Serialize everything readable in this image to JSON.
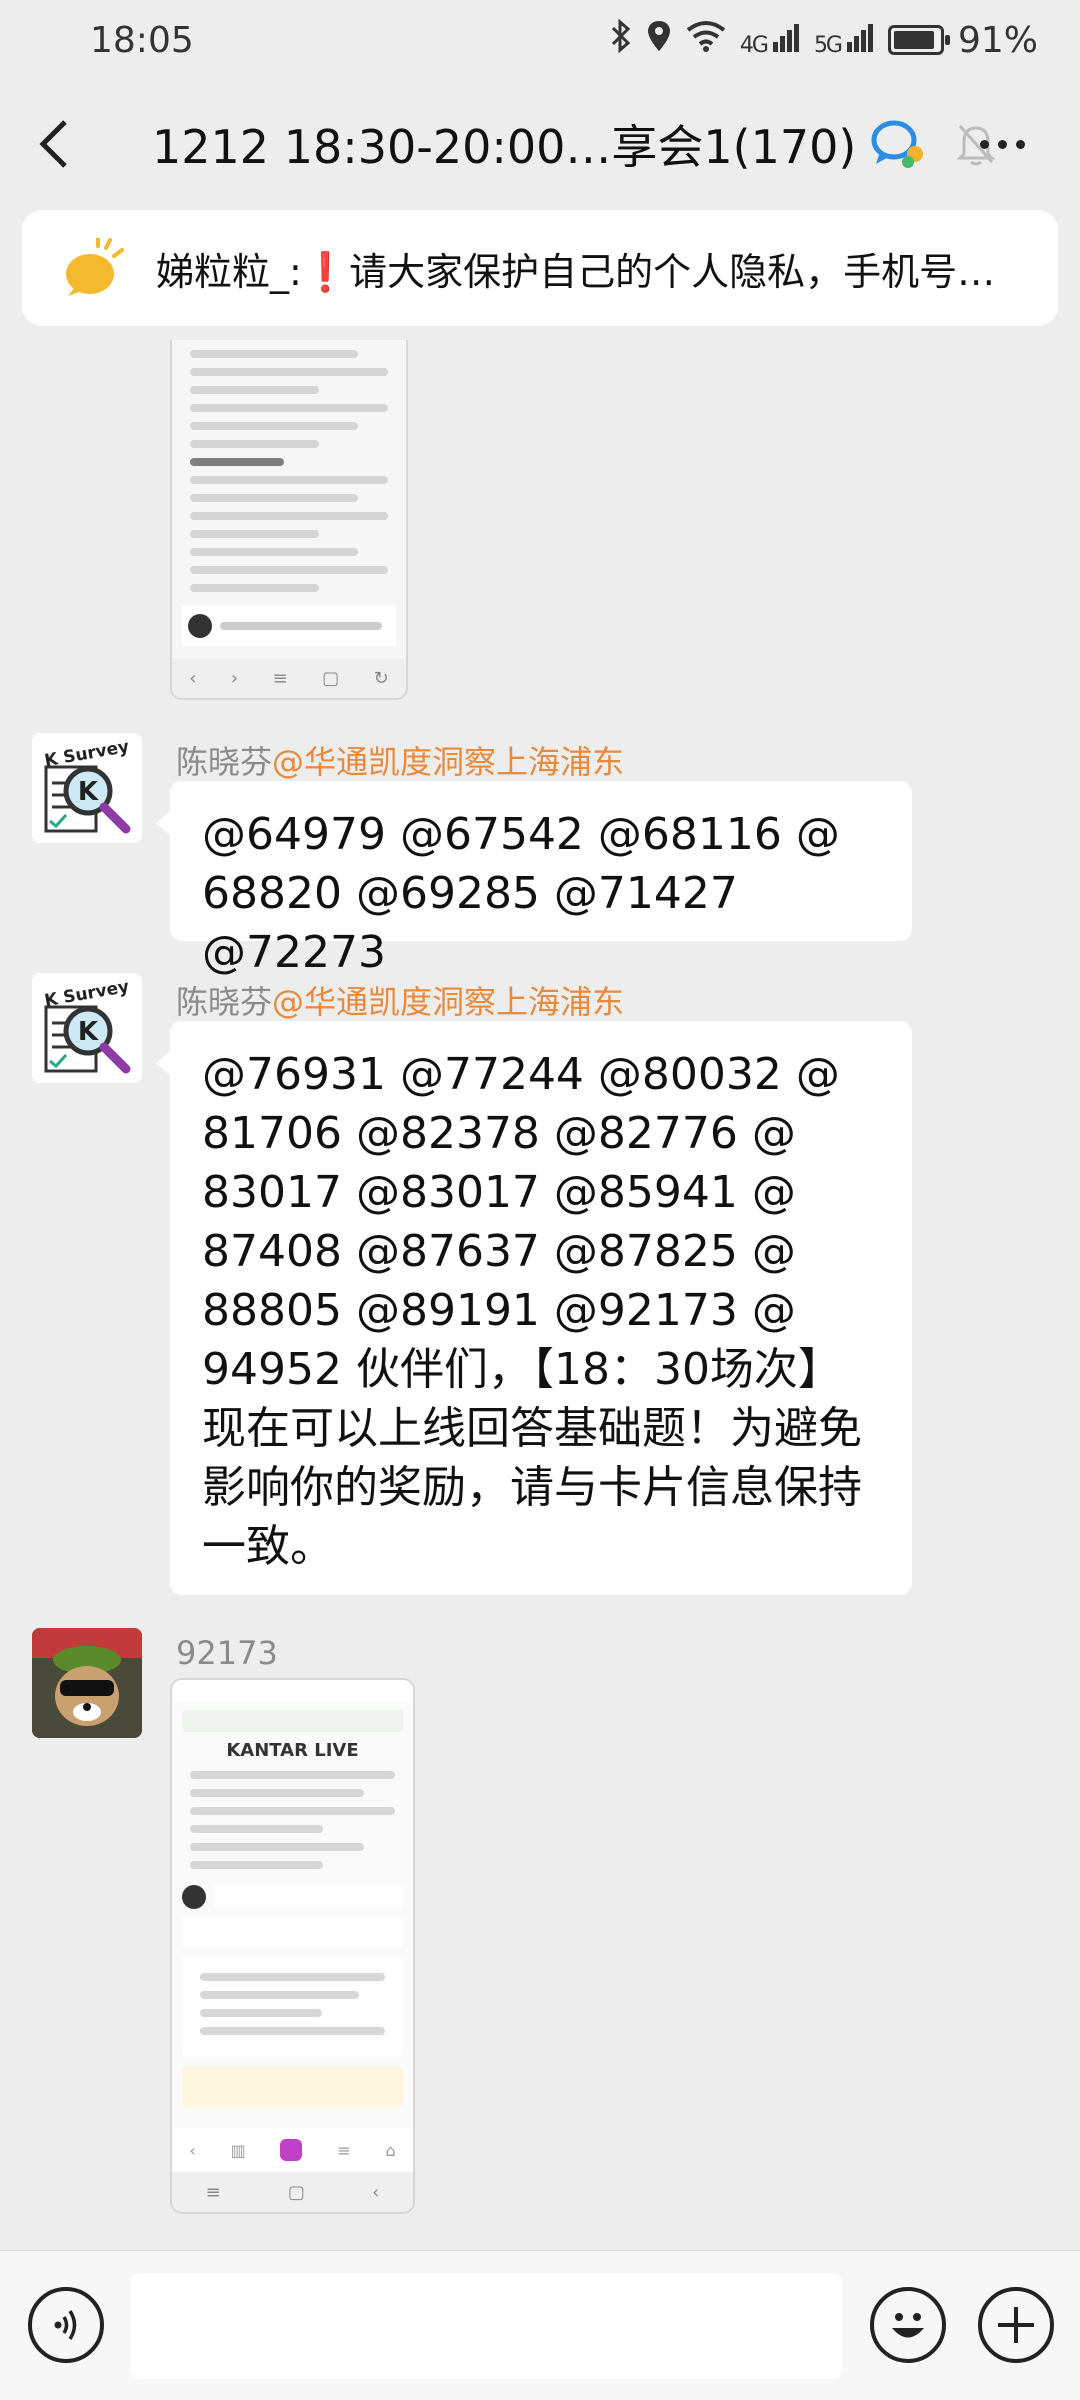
{
  "status": {
    "time": "18:05",
    "net_4g": "4G",
    "net_5g": "5G",
    "battery_pct": "91%"
  },
  "header": {
    "title": "1212 18:30-20:00…享会1(170)",
    "icons": [
      "back-icon",
      "group-chat-icon",
      "mute-bell-icon",
      "more-icon"
    ]
  },
  "pinned": {
    "sender": "娣粒粒_:",
    "mark": "❗",
    "text": "请大家保护自己的个人隐私，手机号…"
  },
  "messages": [
    {
      "sender": "陈晓芬",
      "mention": "@华通凯度洞察上海浦东",
      "text": "@64979 @67542 @68116 @\n68820 @69285 @71427 @72273"
    },
    {
      "sender": "陈晓芬",
      "mention": "@华通凯度洞察上海浦东",
      "text": "@76931 @77244 @80032 @\n81706 @82378 @82776 @\n83017 @83017 @85941 @\n87408 @87637 @87825 @\n88805 @89191 @92173 @\n94952 伙伴们，【18：30场次】\n现在可以上线回答基础题！为避免\n影响你的奖励，请与卡片信息保持\n一致。"
    },
    {
      "sender": "92173",
      "image_caption": "KANTAR LIVE"
    }
  ],
  "avatar": {
    "label": "K Survey",
    "letter": "K"
  },
  "input": {
    "placeholder": ""
  },
  "colors": {
    "background": "#ededed",
    "mention": "#e9893a",
    "alert": "#e6282e",
    "bubble": "#ffffff"
  }
}
